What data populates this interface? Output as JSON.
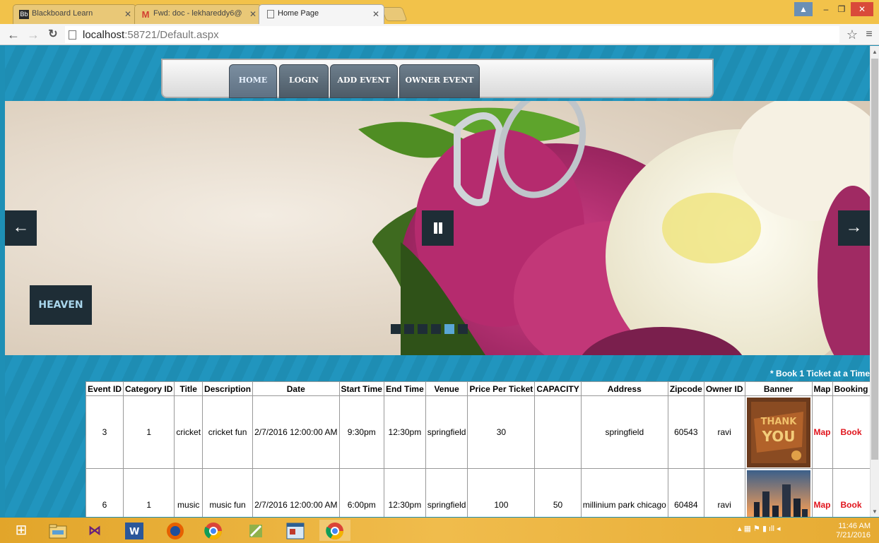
{
  "browser": {
    "tabs": [
      {
        "label": "Blackboard Learn",
        "icon": "blackboard-icon"
      },
      {
        "label": "Fwd: doc - lekhareddy6@",
        "icon": "gmail-icon"
      },
      {
        "label": "Home Page",
        "icon": "page-icon"
      }
    ],
    "url_host": "localhost",
    "url_rest": ":58721/Default.aspx"
  },
  "nav": {
    "items": [
      "HOME",
      "LOGIN",
      "ADD EVENT",
      "OWNER EVENT"
    ],
    "active": "HOME"
  },
  "slider": {
    "caption": "HEAVEN",
    "dot_count": 6,
    "active_dot": 5
  },
  "note": "* Book 1 Ticket at a Time",
  "table": {
    "headers": [
      "Event ID",
      "Category ID",
      "Title",
      "Description",
      "Date",
      "Start Time",
      "End Time",
      "Venue",
      "Price Per Ticket",
      "CAPACITY",
      "Address",
      "Zipcode",
      "Owner ID",
      "Banner",
      "Map",
      "Booking"
    ],
    "rows": [
      {
        "event_id": "3",
        "category_id": "1",
        "title": "cricket",
        "description": "cricket fun",
        "date": "2/7/2016 12:00:00 AM",
        "start": "9:30pm",
        "end": "12:30pm",
        "venue": "springfield",
        "price": "30",
        "capacity": "",
        "address": "springfield",
        "zipcode": "60543",
        "owner": "ravi",
        "banner": "thank-you-banner",
        "map": "Map",
        "book": "Book"
      },
      {
        "event_id": "6",
        "category_id": "1",
        "title": "music",
        "description": "music fun",
        "date": "2/7/2016 12:00:00 AM",
        "start": "6:00pm",
        "end": "12:30pm",
        "venue": "springfield",
        "price": "100",
        "capacity": "50",
        "address": "millinium park chicago",
        "zipcode": "60484",
        "owner": "ravi",
        "banner": "city-skyline-banner",
        "map": "Map",
        "book": "Book"
      }
    ]
  },
  "taskbar": {
    "time": "11:46 AM",
    "date": "7/21/2016"
  }
}
